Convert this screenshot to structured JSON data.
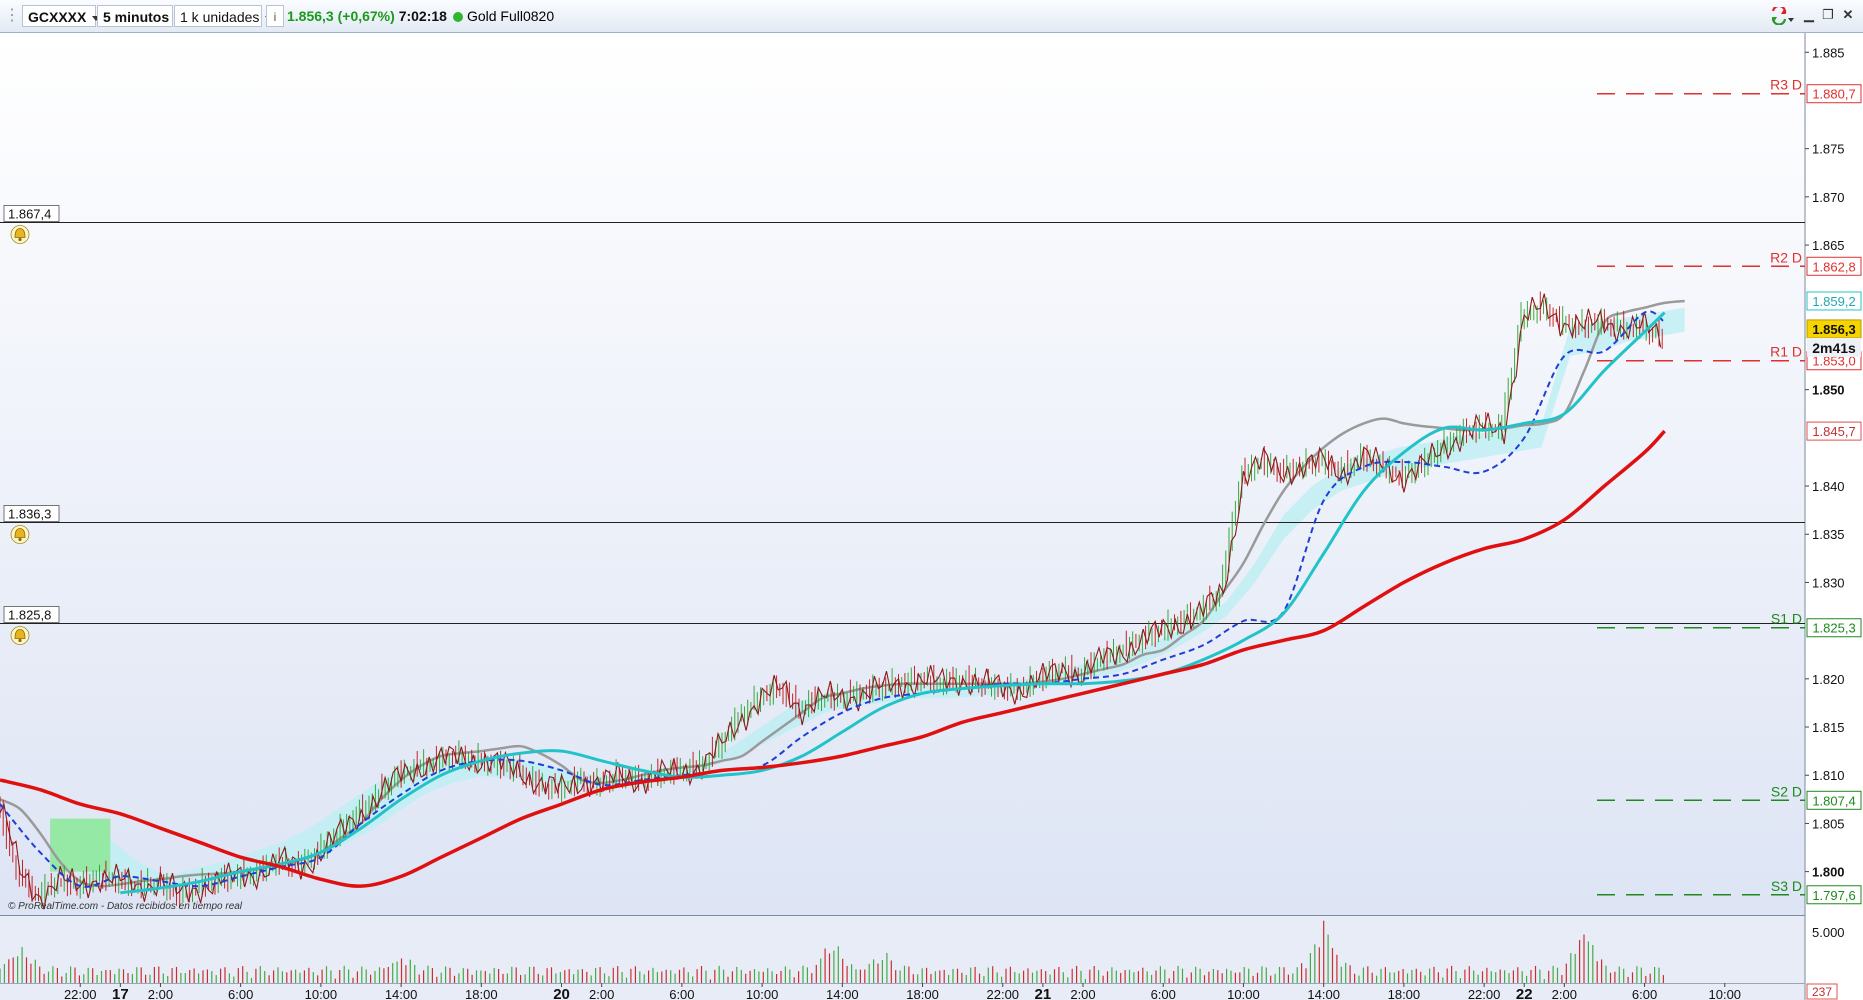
{
  "toolbar": {
    "instrument": "GCXXXX",
    "timeframe": "5 minutos",
    "units": "1 k unidades",
    "last_change": "1.856,3 (+0,67%)",
    "time": "7:02:18",
    "feed": "Gold Full0820"
  },
  "watermark": "© ProRealTime.com - Datos recibidos en tiempo real",
  "colors": {
    "up": "#1a9a1a",
    "down": "#c00000",
    "ma_slow": "#e01010",
    "ma_mid": "#22c3c8",
    "ma_dash": "#1d3fd8",
    "gray_ma": "#9a9a9a",
    "cloud": "#bfeff3",
    "cloud_green": "#8ee89c",
    "price_line": "#8b1a1a",
    "pivot_r": "#e03030",
    "pivot_s": "#1e8a1e",
    "current_price_bg": "#f5d400"
  },
  "chart_data": {
    "type": "line",
    "instrument": "GCXXXX",
    "interval": "5 minutos",
    "ylim": [
      1795.5,
      1887
    ],
    "y_ticks": [
      {
        "v": 1885,
        "label": "1.885"
      },
      {
        "v": 1875,
        "label": "1.875"
      },
      {
        "v": 1870,
        "label": "1.870"
      },
      {
        "v": 1865,
        "label": "1.865"
      },
      {
        "v": 1850,
        "label": "1.850"
      },
      {
        "v": 1840,
        "label": "1.840"
      },
      {
        "v": 1835,
        "label": "1.835"
      },
      {
        "v": 1830,
        "label": "1.830"
      },
      {
        "v": 1820,
        "label": "1.820"
      },
      {
        "v": 1815,
        "label": "1.815"
      },
      {
        "v": 1810,
        "label": "1.810"
      },
      {
        "v": 1805,
        "label": "1.805"
      },
      {
        "v": 1800,
        "label": "1.800"
      }
    ],
    "x_ticks": [
      {
        "t": 0,
        "label": "22:00",
        "bold": false
      },
      {
        "t": 2,
        "label": "17",
        "bold": true
      },
      {
        "t": 4,
        "label": "2:00",
        "bold": false
      },
      {
        "t": 8,
        "label": "6:00",
        "bold": false
      },
      {
        "t": 12,
        "label": "10:00",
        "bold": false
      },
      {
        "t": 16,
        "label": "14:00",
        "bold": false
      },
      {
        "t": 20,
        "label": "18:00",
        "bold": false
      },
      {
        "t": 24,
        "label": "20",
        "bold": true
      },
      {
        "t": 26,
        "label": "2:00",
        "bold": false
      },
      {
        "t": 30,
        "label": "6:00",
        "bold": false
      },
      {
        "t": 34,
        "label": "10:00",
        "bold": false
      },
      {
        "t": 38,
        "label": "14:00",
        "bold": false
      },
      {
        "t": 42,
        "label": "18:00",
        "bold": false
      },
      {
        "t": 46,
        "label": "22:00",
        "bold": false
      },
      {
        "t": 48,
        "label": "21",
        "bold": true
      },
      {
        "t": 50,
        "label": "2:00",
        "bold": false
      },
      {
        "t": 54,
        "label": "6:00",
        "bold": false
      },
      {
        "t": 58,
        "label": "10:00",
        "bold": false
      },
      {
        "t": 62,
        "label": "14:00",
        "bold": false
      },
      {
        "t": 66,
        "label": "18:00",
        "bold": false
      },
      {
        "t": 70,
        "label": "22:00",
        "bold": false
      },
      {
        "t": 72,
        "label": "22",
        "bold": true
      },
      {
        "t": 74,
        "label": "2:00",
        "bold": false
      },
      {
        "t": 78,
        "label": "6:00",
        "bold": false
      },
      {
        "t": 82,
        "label": "10:00",
        "bold": false
      }
    ],
    "x_range": [
      -4.0,
      86.0
    ],
    "horizontal_levels": [
      {
        "value": 1867.4,
        "label": "1.867,4"
      },
      {
        "value": 1836.3,
        "label": "1.836,3"
      },
      {
        "value": 1825.8,
        "label": "1.825,8"
      }
    ],
    "pivots": [
      {
        "name": "R3 D",
        "value": 1880.7,
        "label": "1.880,7",
        "kind": "r"
      },
      {
        "name": "R2 D",
        "value": 1862.8,
        "label": "1.862,8",
        "kind": "r"
      },
      {
        "name": "R1 D",
        "value": 1853.0,
        "label": "1.853,0",
        "kind": "r"
      },
      {
        "name": "S1 D",
        "value": 1825.3,
        "label": "1.825,3",
        "kind": "s"
      },
      {
        "name": "S2 D",
        "value": 1807.4,
        "label": "1.807,4",
        "kind": "s"
      },
      {
        "name": "S3 D",
        "value": 1797.6,
        "label": "1.797,6",
        "kind": "s"
      }
    ],
    "axis_badges": [
      {
        "value": 1859.2,
        "label": "1.859,2",
        "kind": "cyan"
      },
      {
        "value": 1856.3,
        "label": "1.856,3",
        "kind": "current"
      },
      {
        "value": 1845.7,
        "label": "1.845,7",
        "kind": "red"
      }
    ],
    "countdown": "2m41s",
    "series": [
      {
        "role": "price",
        "t": [
          -4,
          -3,
          -2,
          -1,
          0,
          1,
          2,
          3,
          4,
          5,
          6,
          7,
          8,
          9,
          10,
          11,
          12,
          13,
          14,
          15,
          16,
          17,
          18,
          19,
          20,
          21,
          22,
          23,
          24,
          25,
          26,
          27,
          28,
          29,
          30,
          31,
          32,
          33,
          34,
          35,
          36,
          37,
          38,
          39,
          40,
          41,
          42,
          43,
          44,
          45,
          46,
          47,
          48,
          49,
          50,
          51,
          52,
          53,
          54,
          55,
          56,
          57,
          58,
          59,
          60,
          61,
          62,
          63,
          64,
          65,
          66,
          67,
          68,
          69,
          70,
          71,
          72,
          73,
          74,
          75,
          76,
          77,
          78,
          79
        ],
        "v": [
          1807,
          1800,
          1797.5,
          1799,
          1798.5,
          1799.5,
          1799,
          1798.5,
          1799,
          1797.5,
          1798.5,
          1799,
          1799.5,
          1800,
          1801,
          1800.5,
          1802,
          1804,
          1806,
          1808,
          1810,
          1811,
          1811.5,
          1812,
          1811.5,
          1811,
          1810.5,
          1809,
          1808.5,
          1809.5,
          1809,
          1810,
          1809.5,
          1810,
          1810.5,
          1811,
          1813,
          1816,
          1818,
          1819,
          1817,
          1818,
          1818,
          1818.5,
          1819,
          1819.5,
          1820,
          1819.5,
          1820,
          1819.5,
          1819,
          1819,
          1820,
          1821,
          1820.5,
          1822,
          1823,
          1824,
          1825,
          1826,
          1827,
          1829,
          1841,
          1842.5,
          1841.5,
          1842,
          1842.5,
          1841.5,
          1843,
          1842,
          1841,
          1842,
          1844,
          1845.5,
          1846,
          1846,
          1857.5,
          1858.5,
          1857,
          1856.5,
          1857,
          1856.5,
          1856.3,
          1855.5
        ]
      },
      {
        "role": "ma_red",
        "t": [
          -4,
          -2,
          0,
          2,
          4,
          6,
          8,
          10,
          12,
          14,
          16,
          18,
          20,
          22,
          24,
          26,
          28,
          30,
          32,
          34,
          36,
          38,
          40,
          42,
          44,
          46,
          48,
          50,
          52,
          54,
          56,
          58,
          60,
          62,
          64,
          66,
          68,
          70,
          72,
          74,
          76,
          78,
          79
        ],
        "v": [
          1809.5,
          1808.5,
          1807,
          1806,
          1804.5,
          1803,
          1801.5,
          1800.5,
          1799.2,
          1798.5,
          1799.5,
          1801.5,
          1803.5,
          1805.5,
          1807,
          1808.5,
          1809.3,
          1809.8,
          1810.5,
          1810.8,
          1811.3,
          1812,
          1813,
          1814,
          1815.5,
          1816.5,
          1817.5,
          1818.5,
          1819.5,
          1820.5,
          1821.5,
          1823,
          1824,
          1825,
          1827.5,
          1830,
          1832,
          1833.5,
          1834.5,
          1836.5,
          1840,
          1843.5,
          1845.7
        ]
      },
      {
        "role": "ma_cyan",
        "t": [
          2,
          4,
          6,
          8,
          10,
          12,
          14,
          16,
          18,
          20,
          22,
          24,
          26,
          28,
          30,
          32,
          34,
          36,
          38,
          40,
          42,
          44,
          46,
          48,
          50,
          52,
          54,
          56,
          58,
          60,
          62,
          64,
          66,
          68,
          70,
          72,
          74,
          76,
          78,
          79
        ],
        "v": [
          1797.8,
          1798.3,
          1799,
          1800,
          1800.8,
          1802,
          1804.5,
          1807.5,
          1810,
          1811.5,
          1812.3,
          1812.5,
          1811.5,
          1810.5,
          1809.8,
          1810,
          1810.5,
          1812,
          1814.5,
          1817,
          1818.5,
          1819,
          1819.3,
          1819.5,
          1819.5,
          1819.8,
          1820.5,
          1822,
          1824,
          1826.8,
          1833,
          1839.5,
          1843.5,
          1846,
          1845.8,
          1846.5,
          1847.5,
          1852,
          1856,
          1858
        ]
      },
      {
        "role": "ma_dash",
        "t": [
          -4,
          -2,
          0,
          2,
          4,
          6,
          8,
          10,
          12,
          14,
          16,
          18,
          20,
          22,
          24,
          26,
          28,
          30,
          32,
          34,
          36,
          38,
          40,
          42,
          44,
          46,
          48,
          50,
          52,
          54,
          56,
          58,
          60,
          62,
          64,
          66,
          68,
          70,
          72,
          74,
          76,
          78,
          79
        ],
        "v": [
          1807,
          1802,
          1798.5,
          1799.5,
          1799,
          1798.5,
          1799.5,
          1800.5,
          1801.5,
          1805,
          1808,
          1810.5,
          1811.5,
          1811.5,
          1810.5,
          1809,
          1809.5,
          1810,
          1810.5,
          1811,
          1814,
          1816.5,
          1818,
          1818.5,
          1819,
          1819.5,
          1819.5,
          1820,
          1820.5,
          1822,
          1823.5,
          1826,
          1827,
          1838.5,
          1842,
          1842.5,
          1842,
          1841.5,
          1845,
          1853.5,
          1854,
          1858,
          1857
        ]
      },
      {
        "role": "ma_gray",
        "t": [
          -4,
          -3,
          -2,
          -1,
          0,
          1,
          2,
          3,
          4,
          5,
          6,
          7,
          8,
          9,
          10,
          11,
          12,
          13,
          14,
          15,
          16,
          17,
          18,
          19,
          20,
          21,
          22,
          23,
          24,
          25,
          26,
          27,
          28,
          29,
          30,
          31,
          32,
          33,
          34,
          35,
          36,
          37,
          38,
          39,
          40,
          41,
          42,
          43,
          44,
          45,
          46,
          47,
          48,
          49,
          50,
          51,
          52,
          53,
          54,
          55,
          56,
          57,
          58,
          59,
          60,
          61,
          62,
          63,
          64,
          65,
          66,
          67,
          68,
          69,
          70,
          71,
          72,
          73,
          74,
          75,
          76,
          77,
          78,
          79,
          80
        ],
        "v": [
          1807.5,
          1806.5,
          1804,
          1801,
          1799,
          1798.5,
          1798.7,
          1799,
          1799.2,
          1799.5,
          1799.7,
          1799.8,
          1800,
          1800.3,
          1800.8,
          1801.2,
          1802,
          1803.5,
          1805,
          1807.5,
          1809.5,
          1811,
          1812,
          1812.3,
          1812.5,
          1812.8,
          1813,
          1812.2,
          1811,
          1809.5,
          1809.2,
          1809.5,
          1810,
          1810.5,
          1810.8,
          1811,
          1811.5,
          1812,
          1813.5,
          1815,
          1816.5,
          1818,
          1818.5,
          1819,
          1819.3,
          1819.5,
          1819.5,
          1819.5,
          1819.5,
          1819.5,
          1819.5,
          1819.5,
          1819.7,
          1820,
          1820.5,
          1821,
          1821.5,
          1822.5,
          1823,
          1824.5,
          1826,
          1829,
          1832,
          1836,
          1839.5,
          1842,
          1844,
          1845.5,
          1846.5,
          1847,
          1846.5,
          1846.2,
          1846,
          1845.8,
          1845.9,
          1846,
          1846.3,
          1846.5,
          1847.5,
          1852,
          1857,
          1858,
          1858.5,
          1859,
          1859.2
        ]
      }
    ],
    "cloud_upper": [
      1805,
      1803.5,
      1801,
      1799.5,
      1800.3,
      1801,
      1802,
      1803,
      1804.5,
      1806.5,
      1808.5,
      1810.5,
      1811.3,
      1811.7,
      1812,
      1811.8,
      1811.2,
      1810.5,
      1810,
      1809.9,
      1810.2,
      1810.8,
      1811.5,
      1813.5,
      1815.5,
      1817.5,
      1818.5,
      1818.8,
      1819,
      1819.5,
      1819.3,
      1819.1,
      1819.6,
      1820,
      1820.5,
      1821.5,
      1822,
      1823,
      1824.5,
      1826,
      1828,
      1832,
      1837,
      1840,
      1842,
      1843,
      1844,
      1844.5,
      1845.2,
      1845.5,
      1846,
      1846.3,
      1856.5,
      1857,
      1857.5,
      1858,
      1858.5
    ],
    "cloud_lower": [
      1800,
      1799,
      1798,
      1797.8,
      1798.1,
      1798.6,
      1799.2,
      1800,
      1801.2,
      1802.5,
      1804,
      1806,
      1808,
      1809.2,
      1809.9,
      1809.7,
      1809.3,
      1809,
      1809,
      1809.1,
      1809.5,
      1810,
      1810.8,
      1812,
      1813.5,
      1815,
      1816.5,
      1817.2,
      1817.5,
      1818,
      1818,
      1818.1,
      1818.4,
      1818.8,
      1819.2,
      1820,
      1820.5,
      1821.5,
      1822.8,
      1824.5,
      1826.5,
      1830,
      1834.5,
      1837.5,
      1839.5,
      1840.5,
      1841.5,
      1842,
      1842.5,
      1843,
      1843.5,
      1844,
      1853.5,
      1854,
      1855,
      1855.5,
      1856
    ],
    "cloud_green_zone": {
      "t0": -1.5,
      "t1": 1.5,
      "upper": 1805.5,
      "lower": 1800
    },
    "volume": {
      "ylim": [
        0,
        6500
      ],
      "ticks": [
        {
          "v": 5000,
          "label": "5.000"
        }
      ],
      "last_label": "237",
      "spikes": [
        {
          "t": -3,
          "v": 3500
        },
        {
          "t": 16,
          "v": 2300
        },
        {
          "t": 37.5,
          "v": 4100
        },
        {
          "t": 40,
          "v": 2600
        },
        {
          "t": 62,
          "v": 6200
        },
        {
          "t": 75,
          "v": 5500
        }
      ]
    }
  }
}
